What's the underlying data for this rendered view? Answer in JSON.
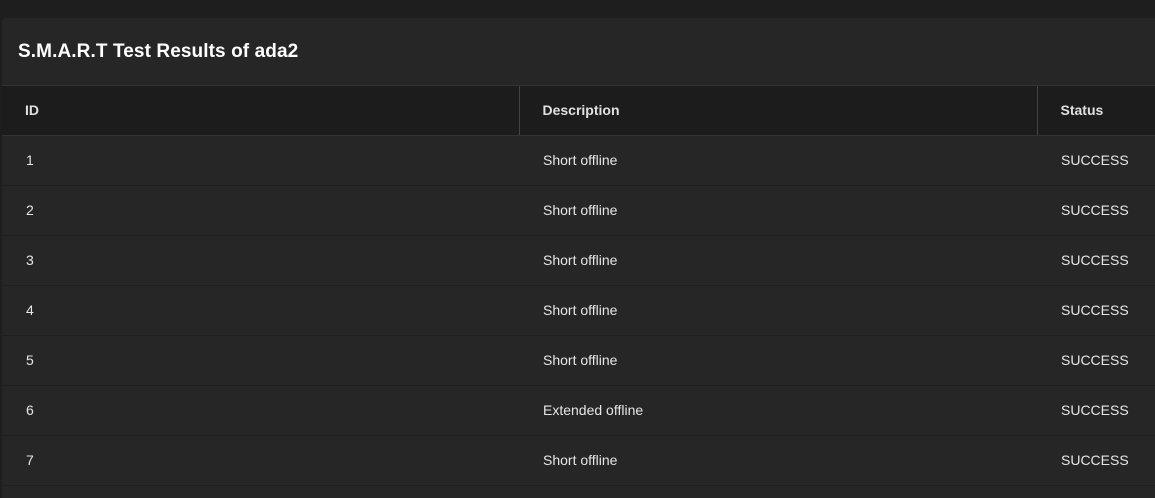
{
  "card": {
    "title": "S.M.A.R.T Test Results of ada2"
  },
  "table": {
    "columns": [
      "ID",
      "Description",
      "Status"
    ],
    "rows": [
      {
        "id": "1",
        "description": "Short offline",
        "status": "SUCCESS"
      },
      {
        "id": "2",
        "description": "Short offline",
        "status": "SUCCESS"
      },
      {
        "id": "3",
        "description": "Short offline",
        "status": "SUCCESS"
      },
      {
        "id": "4",
        "description": "Short offline",
        "status": "SUCCESS"
      },
      {
        "id": "5",
        "description": "Short offline",
        "status": "SUCCESS"
      },
      {
        "id": "6",
        "description": "Extended offline",
        "status": "SUCCESS"
      },
      {
        "id": "7",
        "description": "Short offline",
        "status": "SUCCESS"
      }
    ]
  }
}
